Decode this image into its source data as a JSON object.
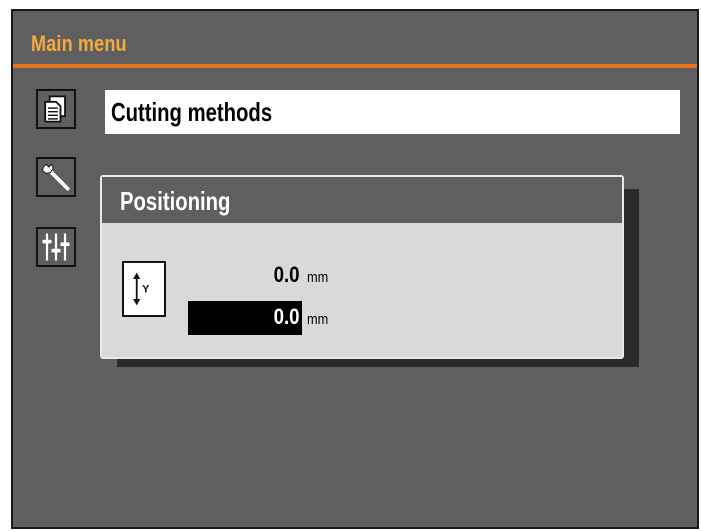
{
  "header": {
    "title": "Main menu",
    "accent_color": "#e8731a",
    "title_color": "#f7a93c"
  },
  "sidebar": {
    "icons": [
      {
        "name": "document-icon"
      },
      {
        "name": "wrench-icon"
      },
      {
        "name": "sliders-icon"
      }
    ]
  },
  "main": {
    "selected_item": "Cutting methods"
  },
  "dialog": {
    "title": "Positioning",
    "axis_icon_label": "Y",
    "current_value": "0.0",
    "current_unit": "mm",
    "target_value": "0.0",
    "target_unit": "mm"
  }
}
